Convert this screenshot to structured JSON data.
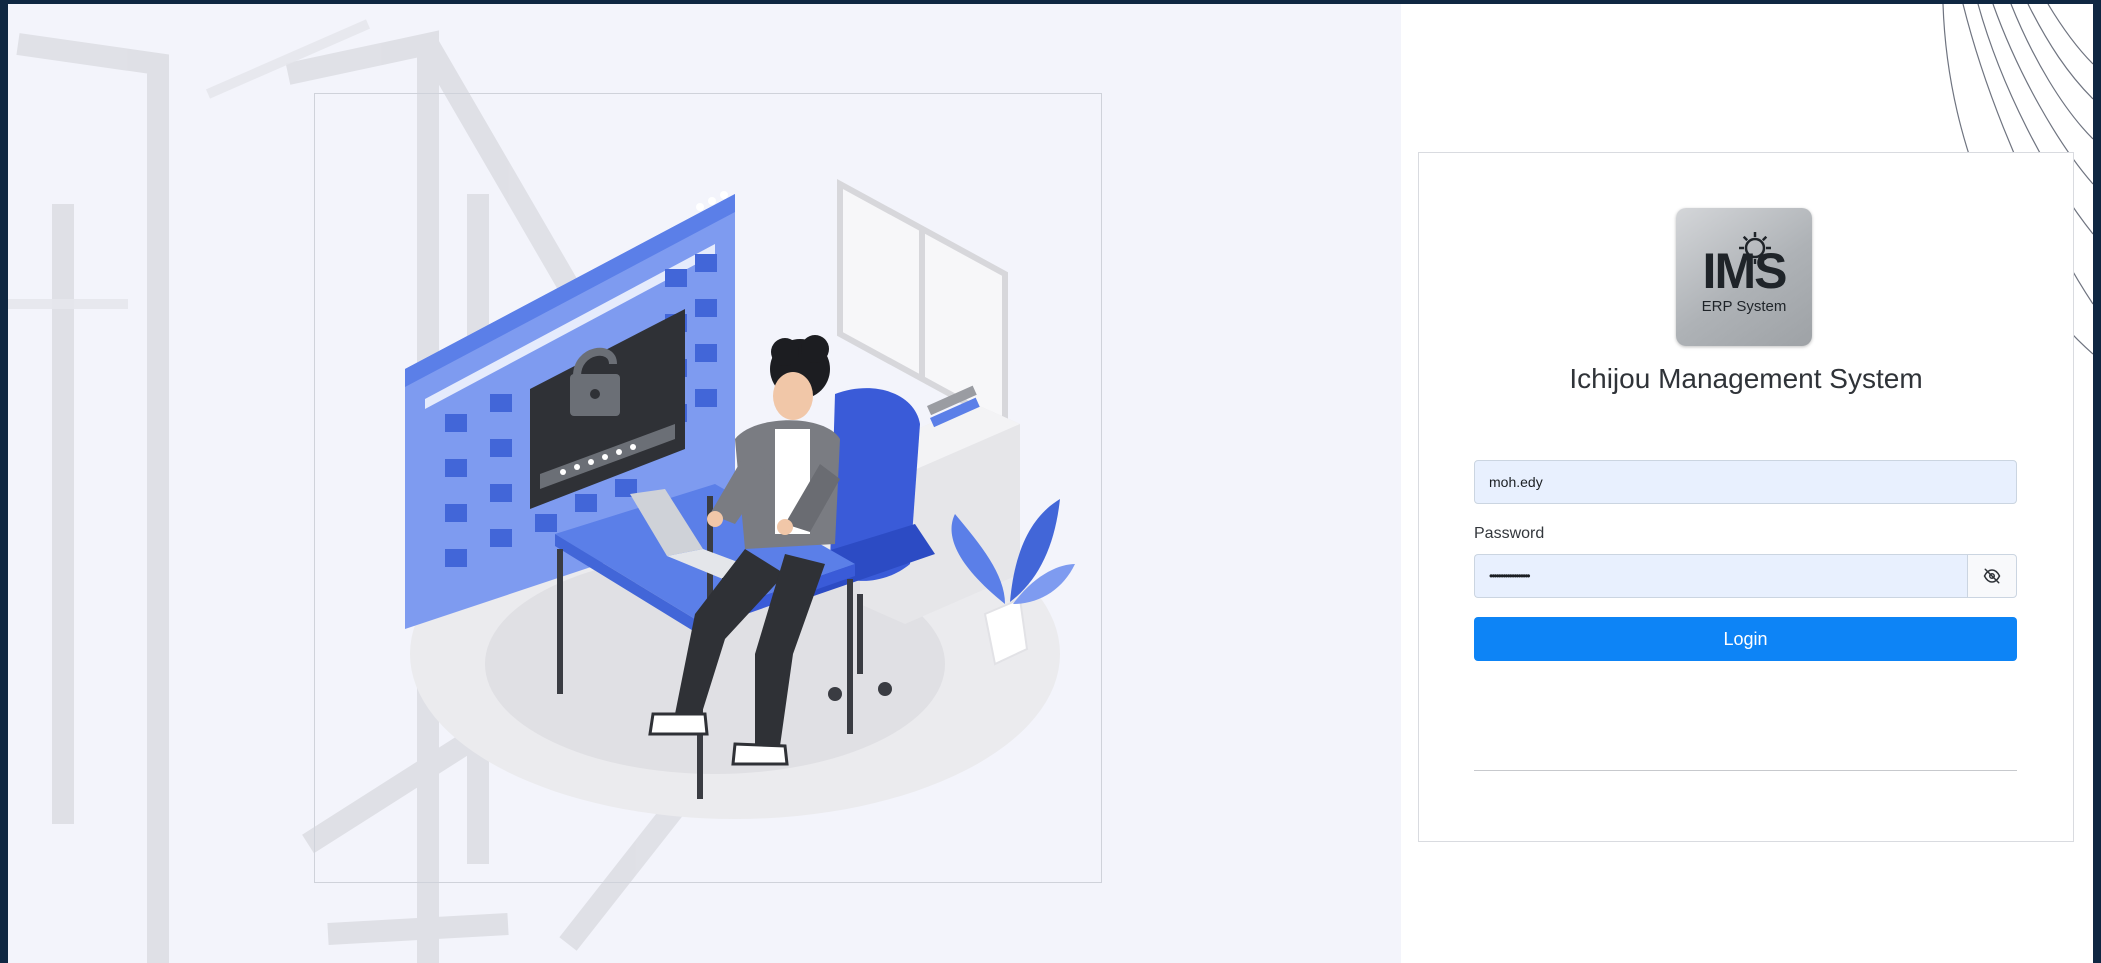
{
  "branding": {
    "logo_mark": "IMS",
    "logo_subtitle": "ERP System",
    "app_title": "Ichijou Management System"
  },
  "login_form": {
    "username_value": "moh.edy",
    "password_label": "Password",
    "password_value": "••••••••••••••••••",
    "toggle_icon": "eye-slash-icon",
    "login_label": "Login"
  },
  "colors": {
    "outer_border": "#0f2742",
    "left_bg": "#f3f4fb",
    "accent": "#0d84f6",
    "input_bg": "#e8f0fe",
    "illustration_blue": "#5b7fe8"
  }
}
